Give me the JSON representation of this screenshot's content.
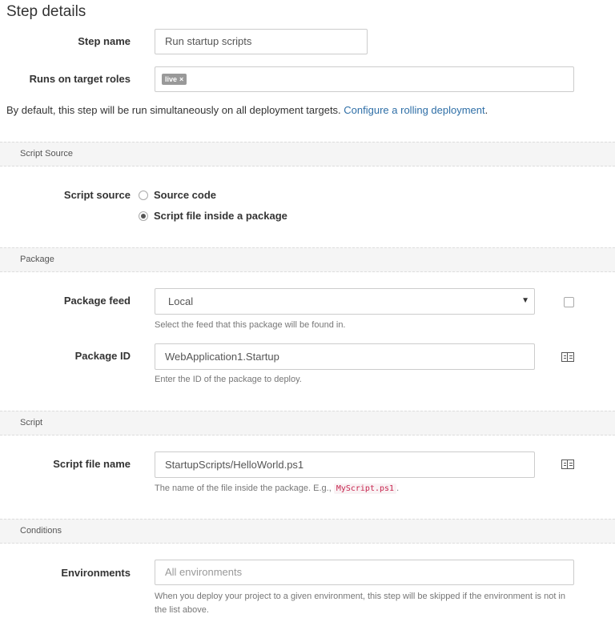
{
  "page": {
    "title": "Step details"
  },
  "step_name": {
    "label": "Step name",
    "value": "Run startup scripts"
  },
  "target_roles": {
    "label": "Runs on target roles",
    "tags": [
      {
        "text": "live",
        "remove": "×"
      }
    ]
  },
  "rolling_note": {
    "text": "By default, this step will be run simultaneously on all deployment targets.",
    "link": "Configure a rolling deployment",
    "suffix": "."
  },
  "sections": {
    "script_source": "Script Source",
    "package": "Package",
    "script": "Script",
    "conditions": "Conditions"
  },
  "script_source": {
    "label": "Script source",
    "options": [
      {
        "label": "Source code",
        "checked": false
      },
      {
        "label": "Script file inside a package",
        "checked": true
      }
    ]
  },
  "package_feed": {
    "label": "Package feed",
    "selected": "Local",
    "arrow": "▼",
    "help": "Select the feed that this package will be found in."
  },
  "package_id": {
    "label": "Package ID",
    "value": "WebApplication1.Startup",
    "help": "Enter the ID of the package to deploy."
  },
  "script_file": {
    "label": "Script file name",
    "value": "StartupScripts/HelloWorld.ps1",
    "help_prefix": "The name of the file inside the package. E.g.,",
    "help_code": "MyScript.ps1",
    "help_suffix": "."
  },
  "environments": {
    "label": "Environments",
    "placeholder": "All environments",
    "help": "When you deploy your project to a given environment, this step will be skipped if the environment is not in the list above."
  },
  "colors": {
    "link": "#2f6fa7",
    "tag_bg": "#999999",
    "section_bg": "#f5f5f5"
  },
  "icons": {
    "variable_binding": "variable-binding-icon"
  }
}
